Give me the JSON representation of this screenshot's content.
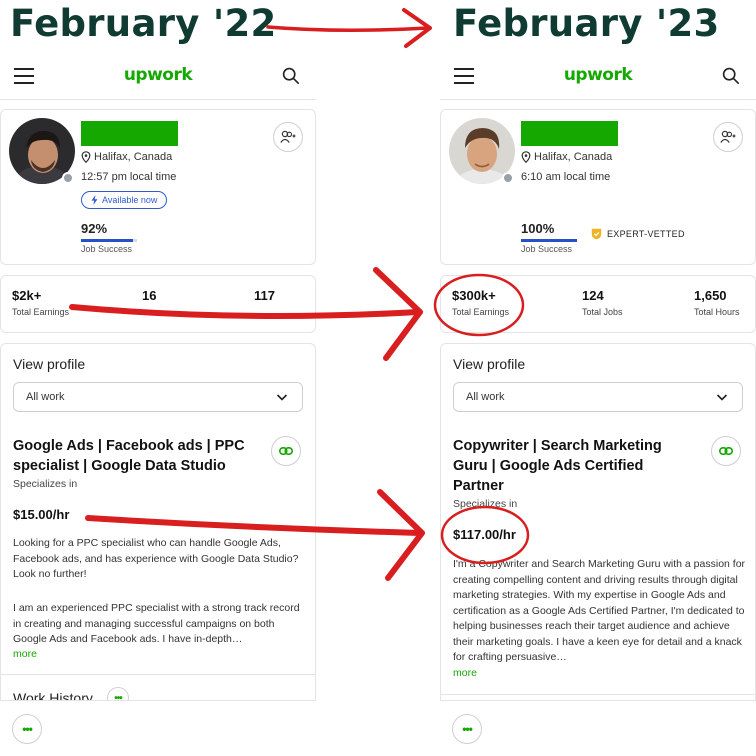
{
  "headings": {
    "left": "February '22",
    "right": "February '23"
  },
  "app": {
    "logo": "upwork",
    "brand_color": "#14a800",
    "heading_color": "#0f3b32",
    "annotation_color": "#d81e1e"
  },
  "before": {
    "location": "Halifax, Canada",
    "local_time": "12:57 pm local time",
    "availability": "Available now",
    "job_success_value": "92%",
    "job_success_fraction": 0.92,
    "job_success_label": "Job Success",
    "stats": [
      {
        "value": "$2k+",
        "label": "Total Earnings"
      },
      {
        "value": "16",
        "label": ""
      },
      {
        "value": "117",
        "label": ""
      }
    ],
    "view_profile": "View profile",
    "filter_selected": "All work",
    "title": "Google Ads | Facebook ads | PPC specialist | Google Data Studio",
    "specializes_in": "Specializes in",
    "rate": "$15.00/hr",
    "desc1": "Looking for a PPC specialist who can handle Google Ads, Facebook ads, and has experience with Google Data Studio? Look no further!",
    "desc2": "I am an experienced PPC specialist with a strong track record in creating and managing successful campaigns on both Google Ads and Facebook ads. I have in-depth…",
    "more": "more",
    "work_history": "Work History",
    "dots": "•••"
  },
  "after": {
    "location": "Halifax, Canada",
    "local_time": "6:10 am local time",
    "job_success_value": "100%",
    "job_success_fraction": 1.0,
    "job_success_label": "Job Success",
    "expert_badge": "EXPERT-VETTED",
    "stats": [
      {
        "value": "$300k+",
        "label": "Total Earnings"
      },
      {
        "value": "124",
        "label": "Total Jobs"
      },
      {
        "value": "1,650",
        "label": "Total Hours"
      }
    ],
    "view_profile": "View profile",
    "filter_selected": "All work",
    "title": "Copywriter | Search Marketing Guru | Google Ads Certified Partner",
    "specializes_in": "Specializes in",
    "rate": "$117.00/hr",
    "desc": "I'm a Copywriter and Search Marketing Guru with a passion for creating compelling content and driving results through digital marketing strategies. With my expertise in Google Ads and certification as a Google Ads Certified Partner, I'm dedicated to helping businesses reach their target audience and achieve their marketing goals. I have a keen eye for detail and a knack for crafting persuasive…",
    "more": "more",
    "dots": "•••"
  }
}
